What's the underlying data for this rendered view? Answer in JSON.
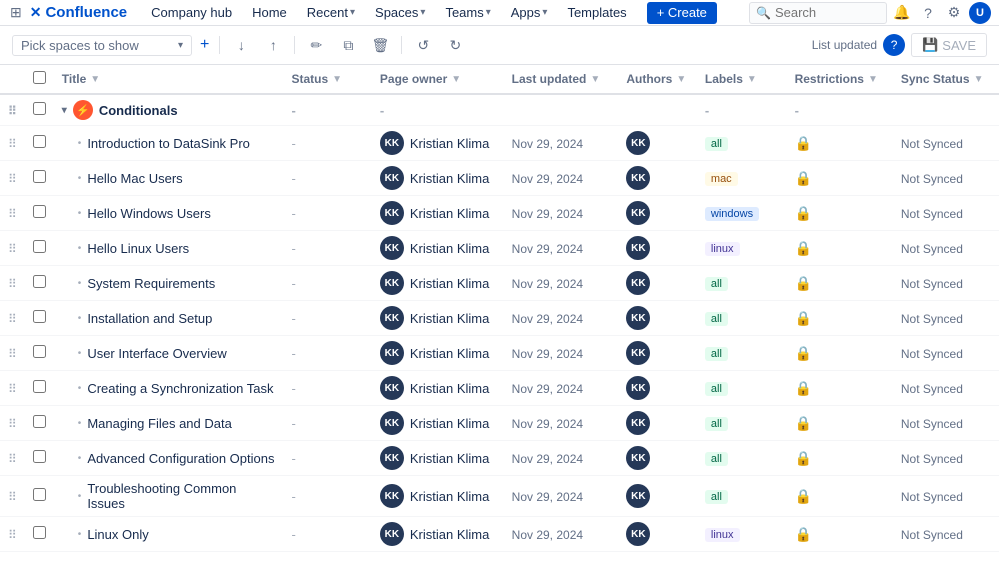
{
  "topnav": {
    "logo": "Confluence",
    "nav_items": [
      {
        "label": "Company hub",
        "has_dropdown": false
      },
      {
        "label": "Home",
        "has_dropdown": false
      },
      {
        "label": "Recent",
        "has_dropdown": true
      },
      {
        "label": "Spaces",
        "has_dropdown": true
      },
      {
        "label": "Teams",
        "has_dropdown": true
      },
      {
        "label": "Apps",
        "has_dropdown": true
      },
      {
        "label": "Templates",
        "has_dropdown": false
      }
    ],
    "create_label": "+ Create",
    "search_placeholder": "Search"
  },
  "toolbar": {
    "space_picker_placeholder": "Pick spaces to show",
    "list_updated": "List updated",
    "save_label": "SAVE"
  },
  "table": {
    "columns": [
      {
        "label": "Title"
      },
      {
        "label": "Status"
      },
      {
        "label": "Page owner"
      },
      {
        "label": "Last updated"
      },
      {
        "label": "Authors"
      },
      {
        "label": "Labels"
      },
      {
        "label": "Restrictions"
      },
      {
        "label": "Sync Status"
      }
    ],
    "rows": [
      {
        "id": "parent",
        "title": "Conditionals",
        "is_parent": true,
        "icon_type": "conditional",
        "status": "",
        "page_owner": "",
        "last_updated": "",
        "authors": "",
        "labels": "",
        "restrictions": "",
        "sync_status": ""
      },
      {
        "id": "row1",
        "title": "Introduction to DataSink Pro",
        "is_parent": false,
        "status": "-",
        "page_owner": "Kristian Klima",
        "owner_initials": "KK",
        "last_updated": "Nov 29, 2024",
        "author_initials": "KK",
        "labels": "all",
        "has_lock": true,
        "sync_status": "Not Synced"
      },
      {
        "id": "row2",
        "title": "Hello Mac Users",
        "is_parent": false,
        "status": "-",
        "page_owner": "Kristian Klima",
        "owner_initials": "KK",
        "last_updated": "Nov 29, 2024",
        "author_initials": "KK",
        "labels": "mac",
        "has_lock": true,
        "sync_status": "Not Synced"
      },
      {
        "id": "row3",
        "title": "Hello Windows Users",
        "is_parent": false,
        "status": "-",
        "page_owner": "Kristian Klima",
        "owner_initials": "KK",
        "last_updated": "Nov 29, 2024",
        "author_initials": "KK",
        "labels": "windows",
        "has_lock": true,
        "sync_status": "Not Synced"
      },
      {
        "id": "row4",
        "title": "Hello Linux Users",
        "is_parent": false,
        "status": "-",
        "page_owner": "Kristian Klima",
        "owner_initials": "KK",
        "last_updated": "Nov 29, 2024",
        "author_initials": "KK",
        "labels": "linux",
        "has_lock": true,
        "sync_status": "Not Synced"
      },
      {
        "id": "row5",
        "title": "System Requirements",
        "is_parent": false,
        "status": "-",
        "page_owner": "Kristian Klima",
        "owner_initials": "KK",
        "last_updated": "Nov 29, 2024",
        "author_initials": "KK",
        "labels": "all",
        "has_lock": true,
        "sync_status": "Not Synced"
      },
      {
        "id": "row6",
        "title": "Installation and Setup",
        "is_parent": false,
        "status": "-",
        "page_owner": "Kristian Klima",
        "owner_initials": "KK",
        "last_updated": "Nov 29, 2024",
        "author_initials": "KK",
        "labels": "all",
        "has_lock": true,
        "sync_status": "Not Synced"
      },
      {
        "id": "row7",
        "title": "User Interface Overview",
        "is_parent": false,
        "status": "-",
        "page_owner": "Kristian Klima",
        "owner_initials": "KK",
        "last_updated": "Nov 29, 2024",
        "author_initials": "KK",
        "labels": "all",
        "has_lock": true,
        "sync_status": "Not Synced"
      },
      {
        "id": "row8",
        "title": "Creating a Synchronization Task",
        "is_parent": false,
        "status": "-",
        "page_owner": "Kristian Klima",
        "owner_initials": "KK",
        "last_updated": "Nov 29, 2024",
        "author_initials": "KK",
        "labels": "all",
        "has_lock": true,
        "sync_status": "Not Synced"
      },
      {
        "id": "row9",
        "title": "Managing Files and Data",
        "is_parent": false,
        "status": "-",
        "page_owner": "Kristian Klima",
        "owner_initials": "KK",
        "last_updated": "Nov 29, 2024",
        "author_initials": "KK",
        "labels": "all",
        "has_lock": true,
        "sync_status": "Not Synced"
      },
      {
        "id": "row10",
        "title": "Advanced Configuration Options",
        "is_parent": false,
        "status": "-",
        "page_owner": "Kristian Klima",
        "owner_initials": "KK",
        "last_updated": "Nov 29, 2024",
        "author_initials": "KK",
        "labels": "all",
        "has_lock": true,
        "sync_status": "Not Synced"
      },
      {
        "id": "row11",
        "title": "Troubleshooting Common Issues",
        "is_parent": false,
        "status": "-",
        "page_owner": "Kristian Klima",
        "owner_initials": "KK",
        "last_updated": "Nov 29, 2024",
        "author_initials": "KK",
        "labels": "all",
        "has_lock": true,
        "sync_status": "Not Synced"
      },
      {
        "id": "row12",
        "title": "Linux Only",
        "is_parent": false,
        "status": "-",
        "page_owner": "Kristian Klima",
        "owner_initials": "KK",
        "last_updated": "Nov 29, 2024",
        "author_initials": "KK",
        "labels": "linux",
        "has_lock": true,
        "sync_status": "Not Synced"
      }
    ]
  }
}
